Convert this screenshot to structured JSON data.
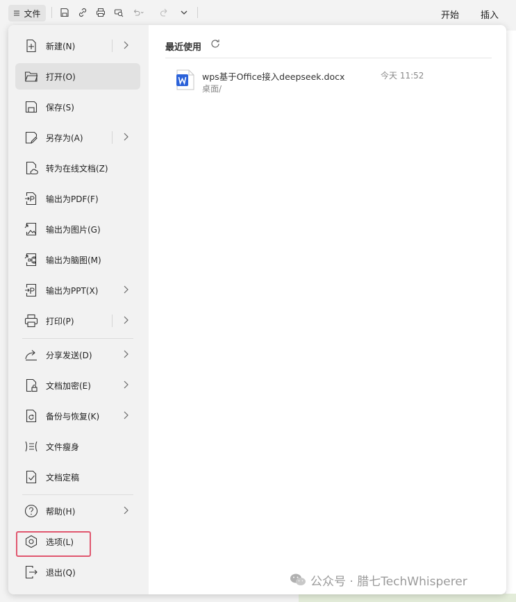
{
  "toolbar": {
    "file_menu_label": "文件",
    "tabs": [
      "开始",
      "插入"
    ]
  },
  "sidebar": {
    "items": [
      {
        "label": "新建(N)",
        "icon": "new-file-icon",
        "submenu": true
      },
      {
        "label": "打开(O)",
        "icon": "open-folder-icon",
        "submenu": false,
        "active": true
      },
      {
        "label": "保存(S)",
        "icon": "save-icon",
        "submenu": false
      },
      {
        "label": "另存为(A)",
        "icon": "save-as-icon",
        "submenu": true
      },
      {
        "label": "转为在线文档(Z)",
        "icon": "cloud-document-icon",
        "submenu": false
      },
      {
        "label": "输出为PDF(F)",
        "icon": "export-pdf-icon",
        "submenu": false
      },
      {
        "label": "输出为图片(G)",
        "icon": "export-image-icon",
        "submenu": false
      },
      {
        "label": "输出为脑图(M)",
        "icon": "export-mindmap-icon",
        "submenu": false
      },
      {
        "label": "输出为PPT(X)",
        "icon": "export-ppt-icon",
        "submenu": true
      },
      {
        "label": "打印(P)",
        "icon": "printer-icon",
        "submenu": true
      },
      {
        "label": "分享发送(D)",
        "icon": "share-icon",
        "submenu": true
      },
      {
        "label": "文档加密(E)",
        "icon": "encrypt-icon",
        "submenu": true
      },
      {
        "label": "备份与恢复(K)",
        "icon": "backup-icon",
        "submenu": true
      },
      {
        "label": "文件瘦身",
        "icon": "slim-file-icon",
        "submenu": false
      },
      {
        "label": "文档定稿",
        "icon": "finalize-icon",
        "submenu": false
      },
      {
        "label": "帮助(H)",
        "icon": "help-icon",
        "submenu": true
      },
      {
        "label": "选项(L)",
        "icon": "options-gear-icon",
        "submenu": false,
        "highlighted": true
      },
      {
        "label": "退出(Q)",
        "icon": "exit-icon",
        "submenu": false
      }
    ]
  },
  "recent": {
    "title": "最近使用",
    "files": [
      {
        "name": "wps基于Office接入deepseek.docx",
        "path": "桌面/",
        "time": "今天 11:52",
        "icon": "word-doc-icon"
      }
    ]
  },
  "watermark": {
    "text": "公众号 · 腊七TechWhisperer"
  },
  "colors": {
    "highlight_border": "#e0566e",
    "word_blue": "#2b62d9",
    "active_item_bg": "#e2e2e2"
  }
}
